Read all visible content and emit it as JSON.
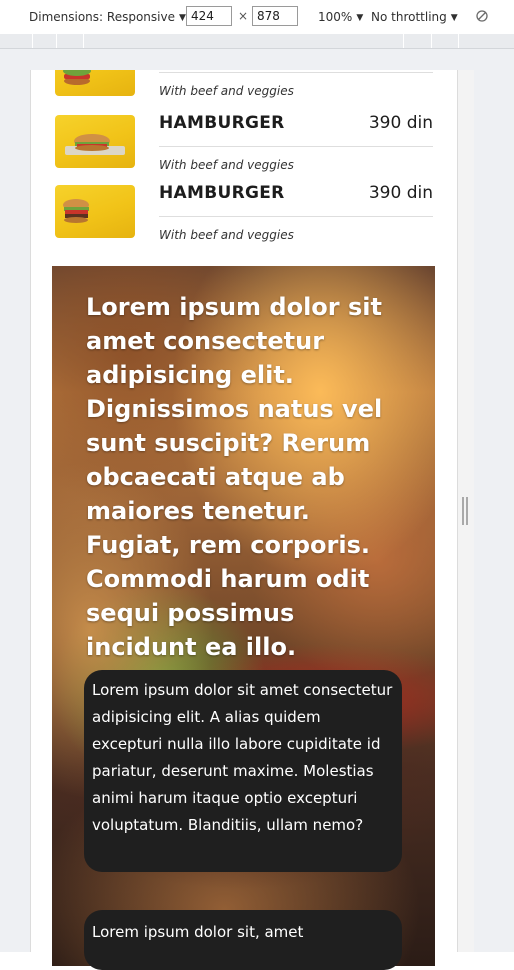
{
  "devtools": {
    "dimensions_label": "Dimensions: Responsive",
    "width_value": "424",
    "height_value": "878",
    "times_sign": "×",
    "zoom": "100%",
    "throttling": "No throttling"
  },
  "menu": {
    "items": [
      {
        "name": "",
        "price": "",
        "description": "With beef and veggies"
      },
      {
        "name": "HAMBURGER",
        "price": "390 din",
        "description": "With beef and veggies"
      },
      {
        "name": "HAMBURGER",
        "price": "390 din",
        "description": "With beef and veggies"
      }
    ]
  },
  "hero": {
    "title": "Lorem ipsum dolor sit amet consectetur adipisicing elit. Dignissimos natus vel sunt suscipit? Rerum obcaecati atque ab maiores tenetur. Fugiat, rem corporis. Commodi harum odit sequi possimus incidunt ea illo.",
    "card_1": "Lorem ipsum dolor sit amet consectetur adipisicing elit. A alias quidem excepturi nulla illo labore cupiditate id pariatur, deserunt maxime. Molestias animi harum itaque optio excepturi voluptatum. Blanditiis, ullam nemo?",
    "card_2": "Lorem ipsum dolor sit, amet"
  },
  "icons": {
    "dropdown": "chevron-down-icon",
    "rotate": "rotate-icon",
    "resize": "resize-handle-icon",
    "food": "hamburger-image"
  }
}
